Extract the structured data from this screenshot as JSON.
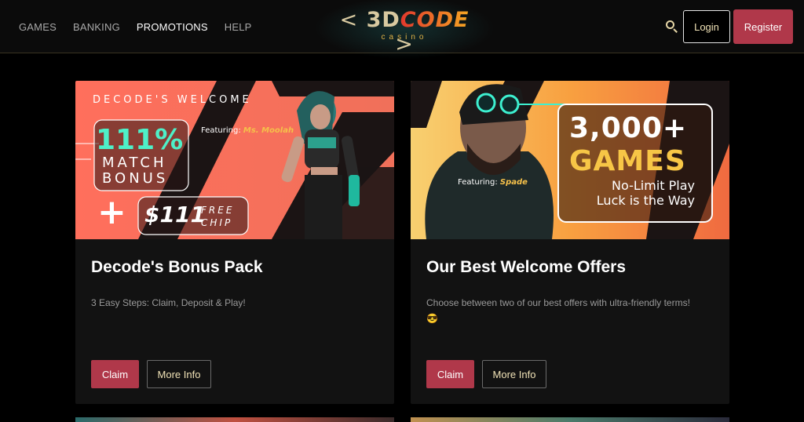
{
  "nav": {
    "items": [
      {
        "label": "GAMES",
        "active": false
      },
      {
        "label": "BANKING",
        "active": false
      },
      {
        "label": "PROMOTIONS",
        "active": true
      },
      {
        "label": "HELP",
        "active": false
      }
    ]
  },
  "logo": {
    "left_bracket": "<",
    "number": "3D",
    "word": "CODE",
    "right_bracket": ">",
    "sub": "casino"
  },
  "header": {
    "search_icon": "search-icon",
    "login_label": "Login",
    "register_label": "Register"
  },
  "colors": {
    "accent": "#b0384a",
    "gold": "#f0e2b6",
    "background": "#000000",
    "card": "#121212"
  },
  "promos": [
    {
      "banner": {
        "heading": "DECODE'S WELCOME",
        "percent": "111%",
        "match": "MATCH",
        "bonus": "BONUS",
        "featuring_prefix": "Featuring:",
        "featuring_name": "Ms. Moolah",
        "plus": "+",
        "chip_amount": "$111",
        "chip_free": "FREE",
        "chip_word": "CHIP"
      },
      "title": "Decode's Bonus Pack",
      "description": "3 Easy Steps: Claim, Deposit & Play!",
      "claim_label": "Claim",
      "more_label": "More Info"
    },
    {
      "banner": {
        "games_count": "3,000+",
        "games_word": "GAMES",
        "line1": "No-Limit Play",
        "line2": "Luck is the Way",
        "featuring_prefix": "Featuring:",
        "featuring_name": "Spade"
      },
      "title": "Our Best Welcome Offers",
      "description": "Choose between two of our best offers with ultra-friendly terms!",
      "emoji": "😎",
      "claim_label": "Claim",
      "more_label": "More Info"
    }
  ]
}
